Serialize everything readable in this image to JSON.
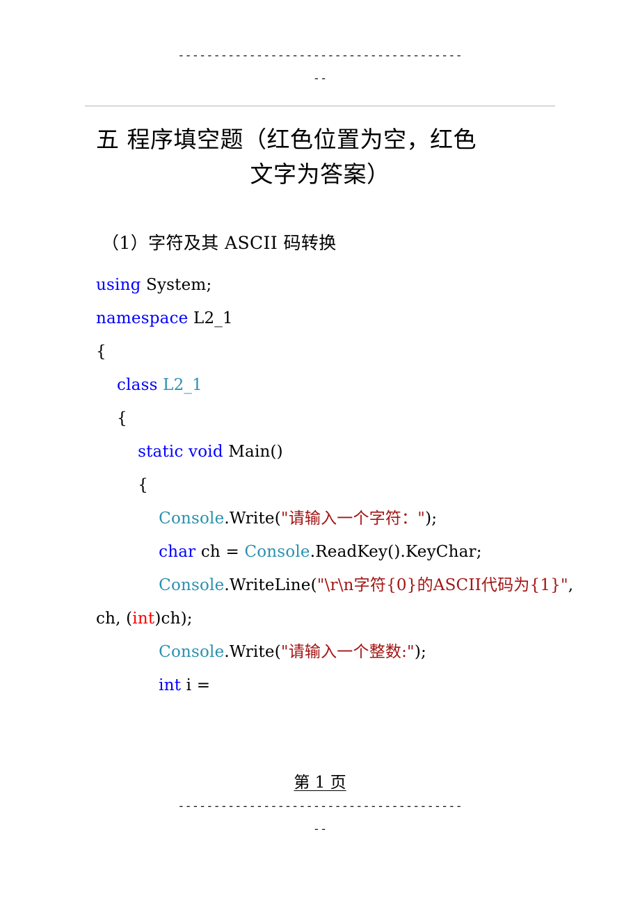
{
  "header": {
    "dash_row": "----------------------------------------",
    "dash_row_short": "--"
  },
  "footer": {
    "dash_row": "----------------------------------------",
    "dash_row_short": "--"
  },
  "page_number": {
    "text": "第 1 页"
  },
  "title": {
    "line1": "五 程序填空题（红色位置为空，红色",
    "line2": "文字为答案）"
  },
  "section": {
    "heading": "（1）字符及其 ASCII 码转换"
  },
  "colors": {
    "keyword": "#0000FF",
    "type": "#2B91AF",
    "string": "#A31515",
    "answer": "#FF0000",
    "plain": "#000000",
    "rule": "#B6B6B6"
  },
  "code": {
    "lines": [
      {
        "indent": "",
        "tokens": [
          {
            "t": "using",
            "c": "kw"
          },
          {
            "t": " System;",
            "c": "plain"
          }
        ]
      },
      {
        "indent": "",
        "tokens": [
          {
            "t": "namespace",
            "c": "kw"
          },
          {
            "t": " L2_1",
            "c": "plain"
          }
        ]
      },
      {
        "indent": "",
        "tokens": [
          {
            "t": "{",
            "c": "plain"
          }
        ]
      },
      {
        "indent": "    ",
        "tokens": [
          {
            "t": "class",
            "c": "kw"
          },
          {
            "t": " ",
            "c": "plain"
          },
          {
            "t": "L2_1",
            "c": "type"
          }
        ]
      },
      {
        "indent": "    ",
        "tokens": [
          {
            "t": "{",
            "c": "plain"
          }
        ]
      },
      {
        "indent": "        ",
        "tokens": [
          {
            "t": "static void",
            "c": "kw"
          },
          {
            "t": " Main()",
            "c": "plain"
          }
        ]
      },
      {
        "indent": "        ",
        "tokens": [
          {
            "t": "{",
            "c": "plain"
          }
        ]
      },
      {
        "indent": "            ",
        "tokens": [
          {
            "t": "Console",
            "c": "type"
          },
          {
            "t": ".Write(",
            "c": "plain"
          },
          {
            "t": "\"请输入一个字符：\"",
            "c": "str"
          },
          {
            "t": ");",
            "c": "plain"
          }
        ]
      },
      {
        "indent": "            ",
        "tokens": [
          {
            "t": "char",
            "c": "kw"
          },
          {
            "t": " ch = ",
            "c": "plain"
          },
          {
            "t": "Console",
            "c": "type"
          },
          {
            "t": ".ReadKey().KeyChar;",
            "c": "plain"
          }
        ]
      },
      {
        "indent": "            ",
        "tokens": [
          {
            "t": "Console",
            "c": "type"
          },
          {
            "t": ".WriteLine(",
            "c": "plain"
          },
          {
            "t": "\"\\r\\n字符{0}的ASCII代码为{1}\"",
            "c": "str"
          },
          {
            "t": ", ch, (",
            "c": "plain"
          },
          {
            "t": "int",
            "c": "ans"
          },
          {
            "t": ")ch);",
            "c": "plain"
          }
        ]
      },
      {
        "indent": "            ",
        "tokens": [
          {
            "t": "Console",
            "c": "type"
          },
          {
            "t": ".Write(",
            "c": "plain"
          },
          {
            "t": "\"请输入一个整数:\"",
            "c": "str"
          },
          {
            "t": ");",
            "c": "plain"
          }
        ]
      },
      {
        "indent": "            ",
        "tokens": [
          {
            "t": "int",
            "c": "kw"
          },
          {
            "t": " i = ",
            "c": "plain"
          }
        ]
      }
    ]
  }
}
